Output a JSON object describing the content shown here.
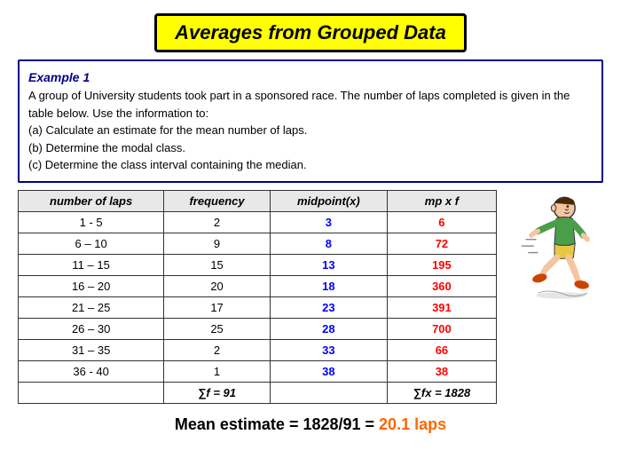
{
  "title": "Averages from Grouped Data",
  "example": {
    "label": "Example 1",
    "text_lines": [
      "A group of University students took part in a sponsored race. The number of",
      "laps completed is given in the table below. Use the information to:",
      "(a) Calculate an estimate for the mean number of laps.",
      "(b) Determine the modal class.",
      "(c) Determine the class interval containing the median."
    ]
  },
  "table": {
    "headers": [
      "number of laps",
      "frequency",
      "midpoint(x)",
      "mp x f"
    ],
    "rows": [
      {
        "laps": "1 - 5",
        "freq": "2",
        "mid": "3",
        "mpf": "6"
      },
      {
        "laps": "6 – 10",
        "freq": "9",
        "mid": "8",
        "mpf": "72"
      },
      {
        "laps": "11 – 15",
        "freq": "15",
        "mid": "13",
        "mpf": "195"
      },
      {
        "laps": "16 – 20",
        "freq": "20",
        "mid": "18",
        "mpf": "360"
      },
      {
        "laps": "21 – 25",
        "freq": "17",
        "mid": "23",
        "mpf": "391"
      },
      {
        "laps": "26 – 30",
        "freq": "25",
        "mid": "28",
        "mpf": "700"
      },
      {
        "laps": "31 – 35",
        "freq": "2",
        "mid": "33",
        "mpf": "66"
      },
      {
        "laps": "36 - 40",
        "freq": "1",
        "mid": "38",
        "mpf": "38"
      }
    ],
    "total_freq": "∑f = 91",
    "total_mpf": "∑fx = 1828"
  },
  "mean_estimate": {
    "text": "Mean estimate = 1828/91 = ",
    "value": "20.1 laps"
  }
}
